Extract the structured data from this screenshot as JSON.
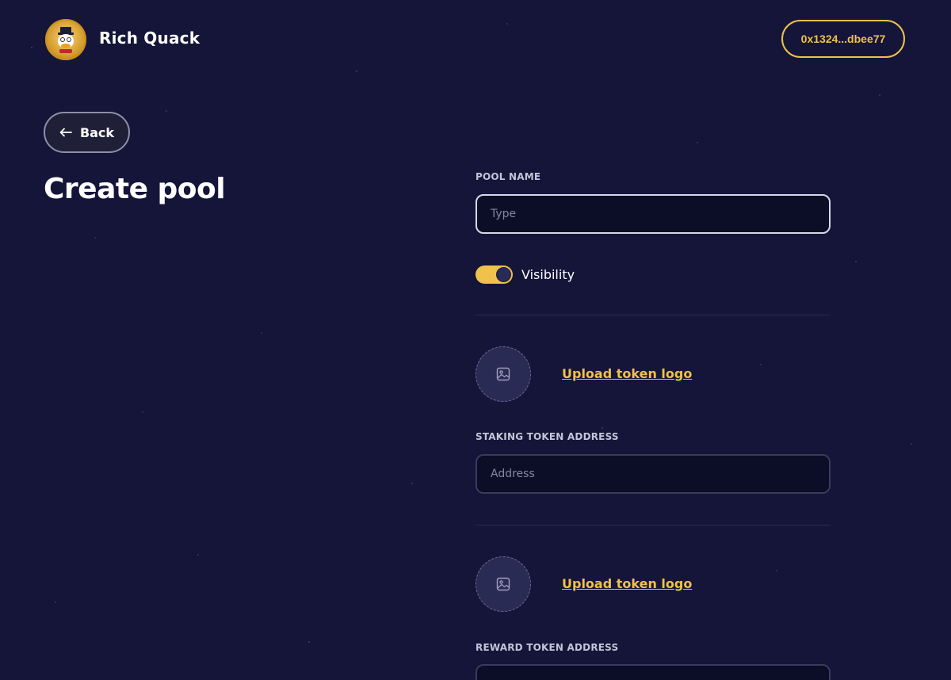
{
  "header": {
    "brand_name": "Rich Quack",
    "wallet_address": "0x1324...dbee77"
  },
  "back": {
    "label": "Back"
  },
  "page": {
    "title": "Create pool"
  },
  "form": {
    "pool_name": {
      "label": "POOL NAME",
      "placeholder": "Type",
      "value": ""
    },
    "visibility": {
      "label": "Visibility",
      "enabled": true
    },
    "staking_logo": {
      "link_label": "Upload token logo"
    },
    "staking_address": {
      "label": "STAKING TOKEN ADDRESS",
      "placeholder": "Address",
      "value": ""
    },
    "reward_logo": {
      "link_label": "Upload token logo"
    },
    "reward_address": {
      "label": "REWARD TOKEN ADDRESS"
    }
  },
  "colors": {
    "background": "#141538",
    "accent": "#f0c14b",
    "input_bg": "#0c0d26"
  }
}
